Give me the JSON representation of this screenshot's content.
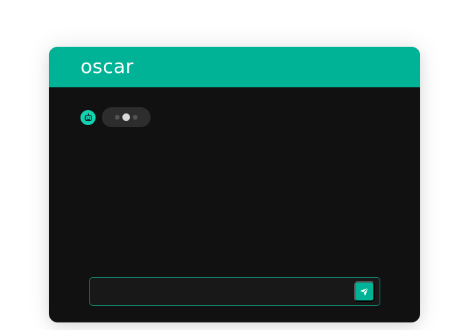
{
  "widget": {
    "brand_name": "oscar",
    "brand_color": "#00b396",
    "avatar_color": "#14d1b2",
    "background_color": "#111111"
  },
  "conversation": {
    "typing_indicator": {
      "state": "typing",
      "dots": 3,
      "active_dot": 2
    }
  },
  "composer": {
    "value": "",
    "placeholder": "",
    "send_icon": "send-icon"
  },
  "icons": {
    "avatar": "bot-icon",
    "send": "send-icon"
  }
}
